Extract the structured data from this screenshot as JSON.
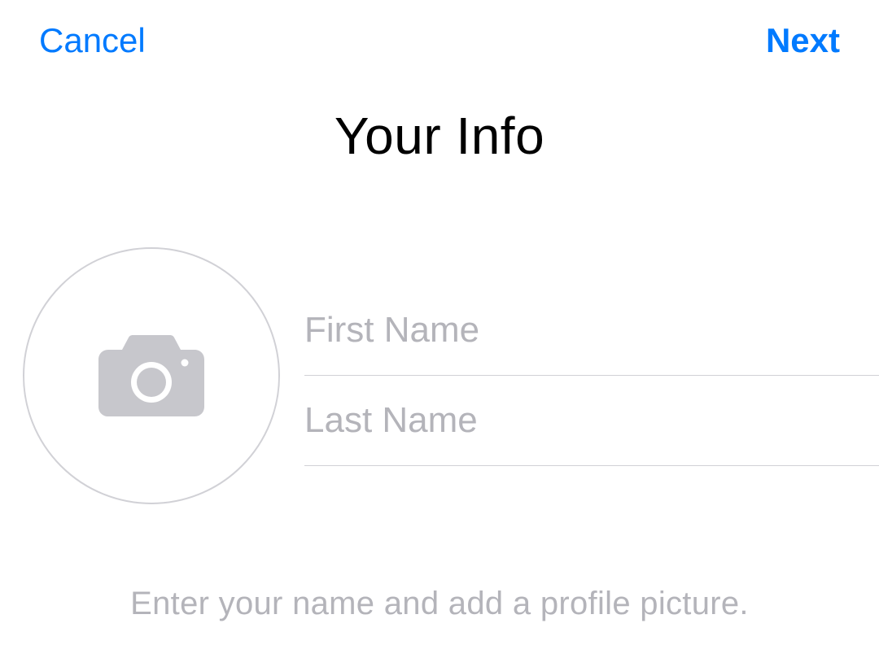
{
  "header": {
    "cancel_label": "Cancel",
    "next_label": "Next"
  },
  "title": "Your Info",
  "form": {
    "first_name_placeholder": "First Name",
    "first_name_value": "",
    "last_name_placeholder": "Last Name",
    "last_name_value": ""
  },
  "hint": "Enter your name and add a profile picture.",
  "icons": {
    "avatar": "camera-icon"
  },
  "colors": {
    "accent": "#007aff",
    "placeholder": "#b4b4ba",
    "divider": "#d1d1d6"
  }
}
